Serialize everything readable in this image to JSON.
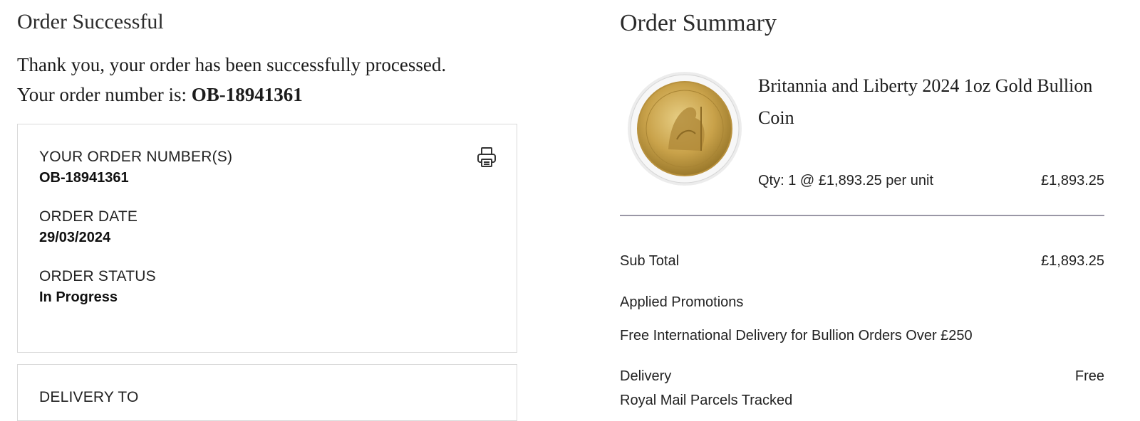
{
  "left": {
    "heading": "Order Successful",
    "thanks": "Thank you, your order has been successfully processed.",
    "order_number_prefix": "Your order number is: ",
    "order_number": "OB-18941361",
    "card": {
      "order_numbers_label": "YOUR ORDER NUMBER(S)",
      "order_numbers_value": "OB-18941361",
      "order_date_label": "ORDER DATE",
      "order_date_value": "29/03/2024",
      "order_status_label": "ORDER STATUS",
      "order_status_value": "In Progress",
      "print_icon": "printer-icon"
    },
    "delivery_card": {
      "label": "DELIVERY TO"
    }
  },
  "right": {
    "heading": "Order Summary",
    "product": {
      "image_icon": "gold-coin-image",
      "name": "Britannia and Liberty 2024 1oz Gold Bullion Coin",
      "qty_text": "Qty: 1 @ £1,893.25 per unit",
      "line_price": "£1,893.25"
    },
    "subtotal_label": "Sub Total",
    "subtotal_value": "£1,893.25",
    "promotions_label": "Applied Promotions",
    "promotion_text": "Free International Delivery for Bullion Orders Over £250",
    "delivery_label": "Delivery",
    "delivery_value": "Free",
    "delivery_method": "Royal Mail Parcels Tracked"
  },
  "colors": {
    "divider": "#9a97a6",
    "card_border": "#d9d9d9",
    "coin_gold": "#c9a24a"
  }
}
